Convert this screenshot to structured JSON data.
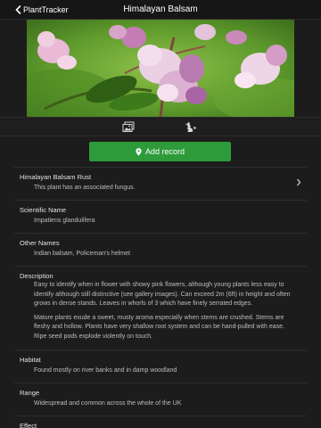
{
  "navbar": {
    "back_label": "PlantTracker",
    "title": "Himalayan Balsam"
  },
  "toolbar": {
    "gallery_icon": "gallery-icon",
    "map_icon": "map-icon"
  },
  "actions": {
    "add_record_label": "Add record",
    "add_record_icon": "location-pin-icon"
  },
  "sections": {
    "associated": {
      "title": "Himalayan Balsam Rust",
      "text": "This plant has an associated fungus."
    },
    "scientific_name": {
      "title": "Scientific Name",
      "text": "Impatiens glandulifera"
    },
    "other_names": {
      "title": "Other Names",
      "text": "Indian balsam, Policeman's helmet"
    },
    "description": {
      "title": "Description",
      "paragraph1": "Easy to identify when in flower with showy pink flowers, although young plants less easy to identify although still distinctive (see gallery images). Can exceed 2m (6ft) in height and often grows in dense stands. Leaves in whorls of 3 which have finely serrated edges.",
      "paragraph2": "Mature plants exude a sweet, musty aroma especially when stems are crushed. Stems are fleshy and hollow. Plants have very shallow root system and can be hand-pulled with ease. Ripe seed pods explode violently on touch."
    },
    "habitat": {
      "title": "Habitat",
      "text": "Found mostly on river banks and in damp woodland"
    },
    "range": {
      "title": "Range",
      "text": "Widespread and common across the whole of the UK"
    },
    "effect": {
      "title": "Effect"
    }
  },
  "colors": {
    "accent_green": "#2e9b3b",
    "background": "#1c1c1c"
  }
}
